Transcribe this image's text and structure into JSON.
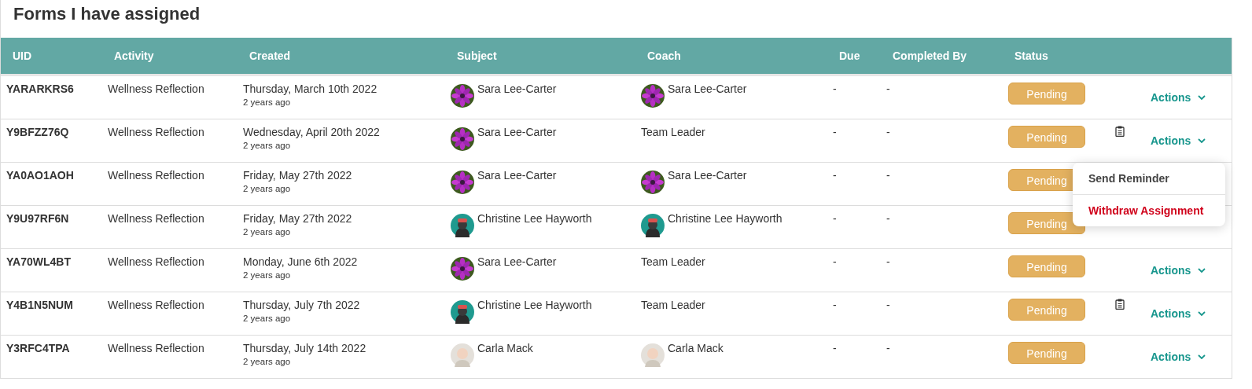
{
  "title": "Forms I have assigned",
  "columns": [
    "UID",
    "Activity",
    "Created",
    "Subject",
    "Coach",
    "Due",
    "Completed By",
    "Status"
  ],
  "rows": [
    {
      "uid": "YARARKRS6",
      "activity": "Wellness Reflection",
      "created": "Thursday, March 10th 2022",
      "ago": "2 years ago",
      "subject": {
        "name": "Sara Lee-Carter",
        "kind": "flower"
      },
      "coach": {
        "name": "Sara Lee-Carter",
        "kind": "flower"
      },
      "due": "-",
      "completed_by": "-",
      "status": "Pending",
      "actions": "Actions"
    },
    {
      "uid": "Y9BFZZ76Q",
      "activity": "Wellness Reflection",
      "created": "Wednesday, April 20th 2022",
      "ago": "2 years ago",
      "subject": {
        "name": "Sara Lee-Carter",
        "kind": "flower"
      },
      "coach": {
        "name": "Team Leader"
      },
      "due": "-",
      "completed_by": "-",
      "status": "Pending",
      "note": true,
      "actions": "Actions",
      "menu": [
        {
          "label": "Send Reminder",
          "kind": "normal"
        },
        {
          "label": "Withdraw Assignment",
          "kind": "danger"
        }
      ]
    },
    {
      "uid": "YA0AO1AOH",
      "activity": "Wellness Reflection",
      "created": "Friday, May 27th 2022",
      "ago": "2 years ago",
      "subject": {
        "name": "Sara Lee-Carter",
        "kind": "flower"
      },
      "coach": {
        "name": "Sara Lee-Carter",
        "kind": "flower"
      },
      "due": "-",
      "completed_by": "-",
      "status": "Pending"
    },
    {
      "uid": "Y9U97RF6N",
      "activity": "Wellness Reflection",
      "created": "Friday, May 27th 2022",
      "ago": "2 years ago",
      "subject": {
        "name": "Christine Lee Hayworth",
        "kind": "character"
      },
      "coach": {
        "name": "Christine Lee Hayworth",
        "kind": "character"
      },
      "due": "-",
      "completed_by": "-",
      "status": "Pending"
    },
    {
      "uid": "YA70WL4BT",
      "activity": "Wellness Reflection",
      "created": "Monday, June 6th 2022",
      "ago": "2 years ago",
      "subject": {
        "name": "Sara Lee-Carter",
        "kind": "flower"
      },
      "coach": {
        "name": "Team Leader"
      },
      "due": "-",
      "completed_by": "-",
      "status": "Pending",
      "actions": "Actions"
    },
    {
      "uid": "Y4B1N5NUM",
      "activity": "Wellness Reflection",
      "created": "Thursday, July 7th 2022",
      "ago": "2 years ago",
      "subject": {
        "name": "Christine Lee Hayworth",
        "kind": "character"
      },
      "coach": {
        "name": "Team Leader"
      },
      "due": "-",
      "completed_by": "-",
      "status": "Pending",
      "note": true,
      "actions": "Actions"
    },
    {
      "uid": "Y3RFC4TPA",
      "activity": "Wellness Reflection",
      "created": "Thursday, July 14th 2022",
      "ago": "2 years ago",
      "subject": {
        "name": "Carla Mack"
      },
      "coach": {
        "name": "Carla Mack"
      },
      "due": "-",
      "completed_by": "-",
      "status": "Pending",
      "actions": "Actions"
    }
  ]
}
